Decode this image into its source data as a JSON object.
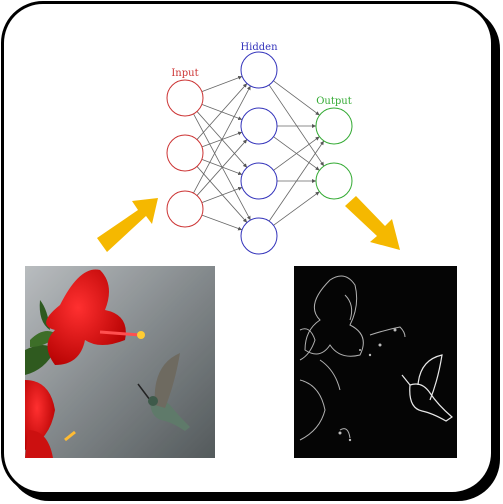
{
  "network": {
    "input_label": "Input",
    "hidden_label": "Hidden",
    "output_label": "Output",
    "input_count": 3,
    "hidden_count": 4,
    "output_count": 2,
    "colors": {
      "input": "#cc3333",
      "hidden": "#3333bb",
      "output": "#33aa33",
      "edge": "#666666",
      "arrow": "#f5b800"
    }
  },
  "images": {
    "input_photo": "hummingbird-hibiscus-photo",
    "output_photo": "edge-detected-feature-map"
  }
}
